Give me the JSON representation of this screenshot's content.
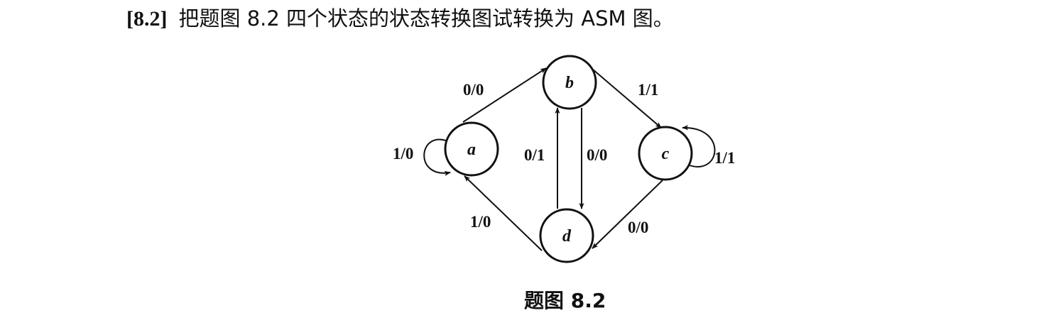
{
  "question": {
    "number": "[8.2]",
    "text": "把题图 8.2 四个状态的状态转换图试转换为 ASM 图。"
  },
  "diagram": {
    "states": {
      "a": "a",
      "b": "b",
      "c": "c",
      "d": "d"
    },
    "transitions": {
      "a_self": "1/0",
      "a_to_b": "0/0",
      "b_to_c": "1/1",
      "c_self": "1/1",
      "b_to_d": "0/0",
      "d_to_b": "0/1",
      "c_to_d": "0/0",
      "d_to_a": "1/0"
    }
  },
  "caption": "题图 8.2"
}
